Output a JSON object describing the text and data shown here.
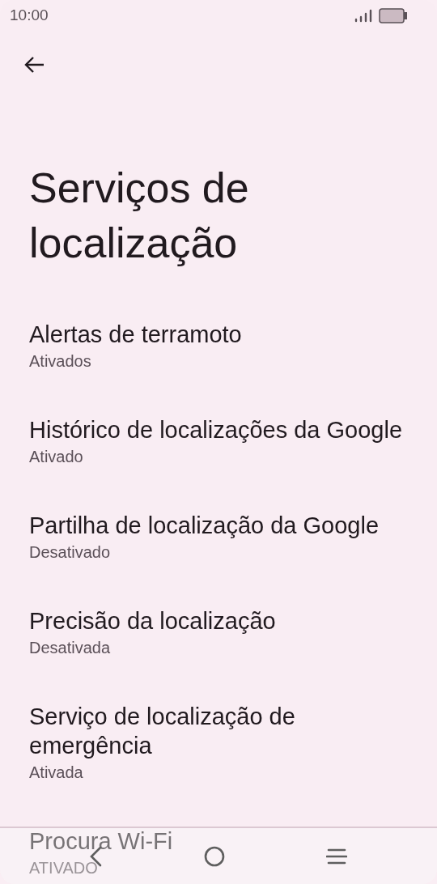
{
  "status_bar": {
    "time": "10:00"
  },
  "title": "Serviços de localização",
  "items": [
    {
      "title": "Alertas de terramoto",
      "summary": "Ativados"
    },
    {
      "title": "Histórico de localizações da Google",
      "summary": "Ativado"
    },
    {
      "title": "Partilha de localização da Google",
      "summary": "Desativado"
    },
    {
      "title": "Precisão da localização",
      "summary": "Desativada"
    },
    {
      "title": "Serviço de localização de emergência",
      "summary": "Ativada"
    },
    {
      "title": "Procura Wi-Fi",
      "summary": "ATIVADO"
    }
  ]
}
